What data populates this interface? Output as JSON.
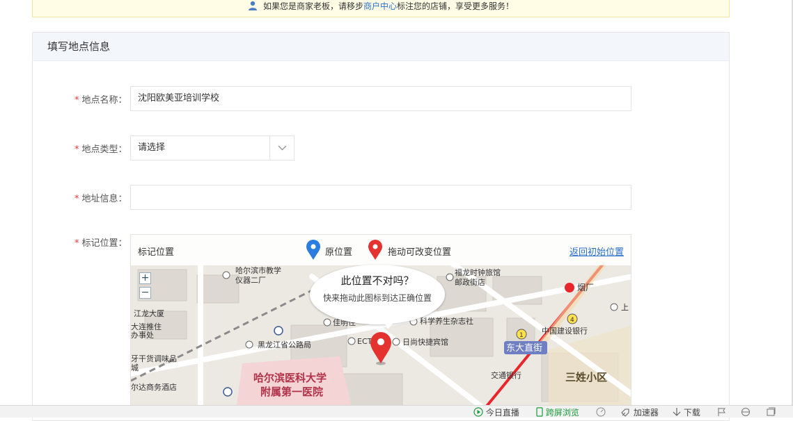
{
  "notice": {
    "prefix": "如果您是商家老板，请移步",
    "link": "商户中心",
    "suffix": "标注您的店铺，享受更多服务！"
  },
  "panel": {
    "title": "填写地点信息"
  },
  "form": {
    "required_mark": "*",
    "name": {
      "label": "地点名称：",
      "value": "沈阳欧美亚培训学校"
    },
    "type": {
      "label": "地点类型：",
      "value": "请选择"
    },
    "address": {
      "label": "地址信息：",
      "value": ""
    },
    "marker": {
      "label": "标记位置："
    }
  },
  "map": {
    "bar_title": "标记位置",
    "legend_original": "原位置",
    "legend_drag": "拖动可改变位置",
    "reset_link": "返回初始位置",
    "bubble_question": "此位置不对吗？",
    "bubble_hint": "快来拖动此图标到达正确位置",
    "zoom_in": "+",
    "zoom_out": "−",
    "labels": {
      "hospital_top": "哈尔滨医科大学",
      "hospital_bottom": "附属第一医院",
      "district": "三姓小区",
      "street": "东大直街",
      "ccb": "中国建设银行",
      "bocom": "交通银行",
      "yanchang": "烟厂",
      "kexue": "科学养生杂志社",
      "rixin": "日尚快捷宾馆",
      "heilongjiang": "黑龙江省公路局",
      "jiamingzhu": "佳明住",
      "shijiao": "哈尔滨市教学",
      "yiqi": "仪器二厂",
      "fulong": "福龙时钟旅馆",
      "youzheng": "邮政街店",
      "jianglong": "江龙大厦",
      "dalian1": "大连推住",
      "dalian2": "办事处",
      "ganhuo1": "牙干货调味品",
      "ganhuo2": "城",
      "hotel": "尔达商务酒店",
      "ect": "ECT",
      "shang": "上",
      "line1": "1",
      "line4": "4"
    }
  },
  "bottom_bar": {
    "live": "今日直播",
    "split": "跨屏浏览",
    "accel": "加速器",
    "download": "下载"
  },
  "colors": {
    "link": "#2a6fc9",
    "required": "#e4393c",
    "pin_blue": "#2b7de0",
    "pin_red": "#e3322f",
    "metro_red": "#e8262b",
    "station_label_bg": "#6f7fc4"
  }
}
